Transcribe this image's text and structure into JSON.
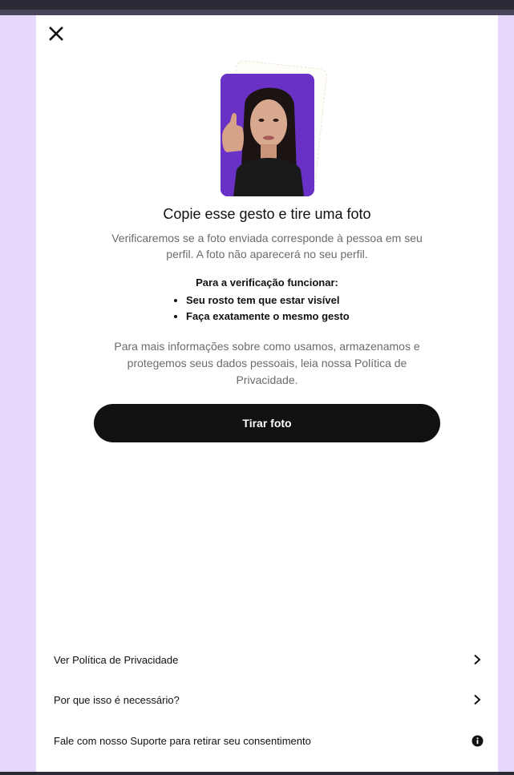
{
  "header": {
    "close_icon": "close-icon"
  },
  "hero": {
    "image_alt": "gesture-example-photo",
    "title": "Copie esse gesto e tire uma foto",
    "subtitle": "Verificaremos se a foto enviada corresponde à pessoa em seu perfil. A foto não aparecerá no seu perfil."
  },
  "requirements": {
    "heading": "Para a verificação funcionar:",
    "items": [
      "Seu rosto tem que estar visível",
      "Faça exatamente o mesmo gesto"
    ]
  },
  "info": {
    "text": "Para mais informações sobre como usamos, armazenamos e protegemos seus dados pessoais, leia nossa Política de Privacidade."
  },
  "actions": {
    "take_photo_label": "Tirar foto"
  },
  "footer_links": [
    {
      "label": "Ver Política de Privacidade",
      "icon": "chevron-right-icon"
    },
    {
      "label": "Por que isso é necessário?",
      "icon": "chevron-right-icon"
    },
    {
      "label": "Fale com nosso Suporte para retirar seu consentimento",
      "icon": "info-icon"
    }
  ],
  "colors": {
    "page_background": "#e6d8fc",
    "panel_background": "#ffffff",
    "primary_button": "#111111",
    "photo_background": "#6a31c7"
  }
}
